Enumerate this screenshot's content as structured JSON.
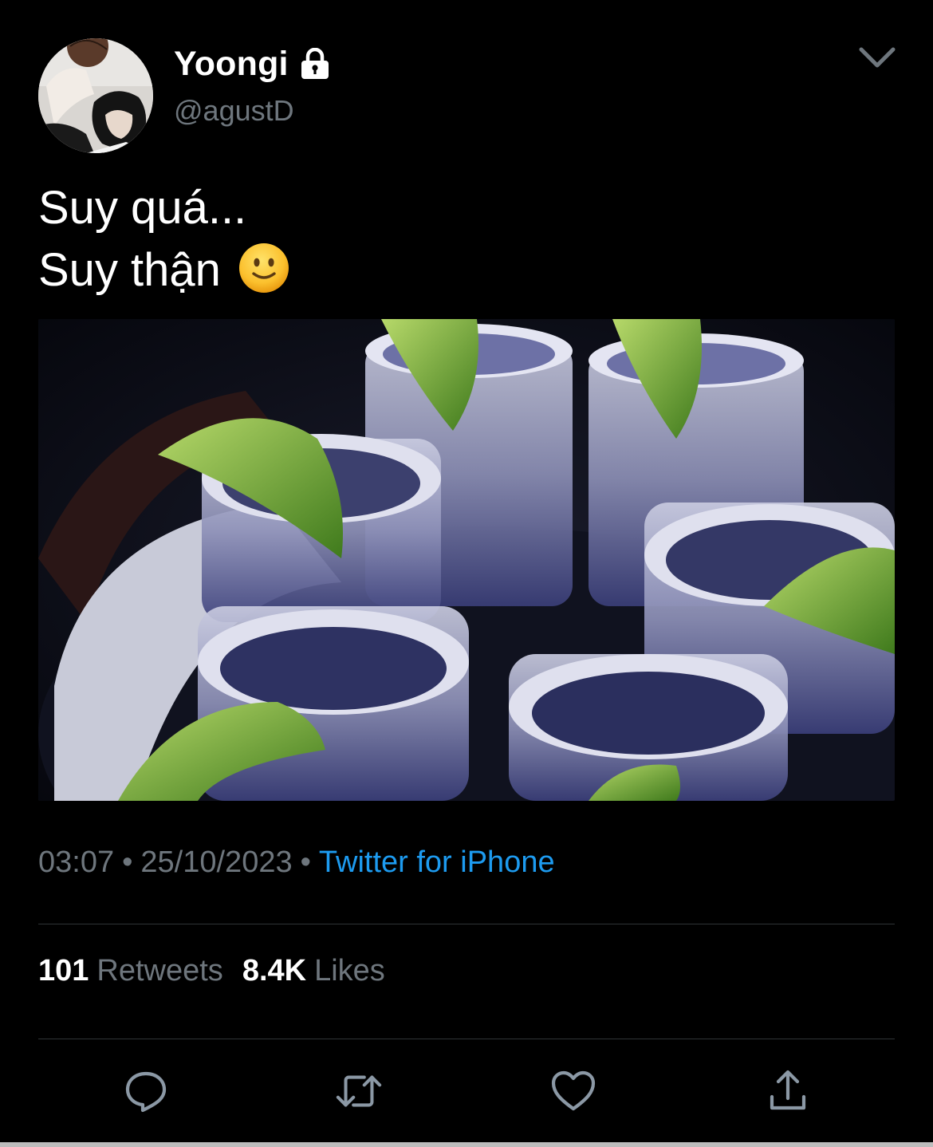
{
  "author": {
    "display_name": "Yoongi",
    "handle": "@agustD",
    "protected": true
  },
  "tweet": {
    "lines": [
      "Suy quá...",
      "Suy thận"
    ],
    "emoji": "slightly-smiling-face"
  },
  "meta": {
    "time": "03:07",
    "separator": "•",
    "date": "25/10/2023",
    "source": "Twitter for iPhone"
  },
  "stats": {
    "retweets_count": "101",
    "retweets_label": "Retweets",
    "likes_count": "8.4K",
    "likes_label": "Likes"
  },
  "actions": [
    "reply-icon",
    "retweet-icon",
    "like-icon",
    "share-icon"
  ],
  "colors": {
    "background": "#000000",
    "text": "#ffffff",
    "secondary": "#6e767d",
    "link": "#1d9bf0",
    "divider": "#2f3336"
  }
}
